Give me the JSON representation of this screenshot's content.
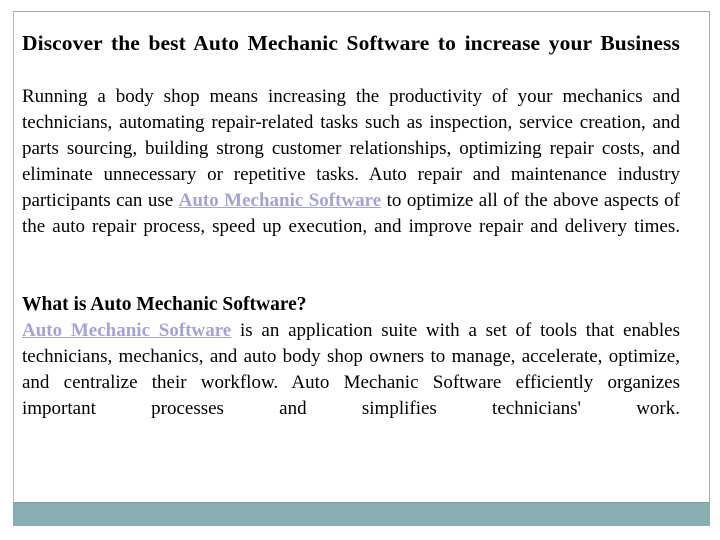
{
  "slide": {
    "title_line_1": "Discover the best Auto Mechanic Software to increase your Business",
    "heading_2": "What is Auto Mechanic Software?",
    "link_text": "Auto Mechanic Software",
    "paragraph_1_before_link": "Running a body shop means increasing the productivity of your mechanics and technicians, automating repair-related tasks such as inspection, service creation, and parts sourcing, building strong customer relationships, optimizing repair costs, and eliminate unnecessary or repetitive tasks. Auto repair and maintenance industry participants can use ",
    "paragraph_1_after_link": " to optimize all of the above aspects of the auto repair process, speed up execution, and improve repair and delivery times.",
    "paragraph_2_after_link": " is an application suite with a set of tools that enables technicians, mechanics, and auto body shop owners to manage, accelerate, optimize, and centralize their workflow. Auto Mechanic Software efficiently organizes important processes and simplifies technicians' work."
  },
  "colors": {
    "footer_bar": "#8aafb3",
    "link": "#a3a3d6",
    "frame_border": "#a8a8ae",
    "body_text": "#000000",
    "page_background": "#ffffff"
  }
}
